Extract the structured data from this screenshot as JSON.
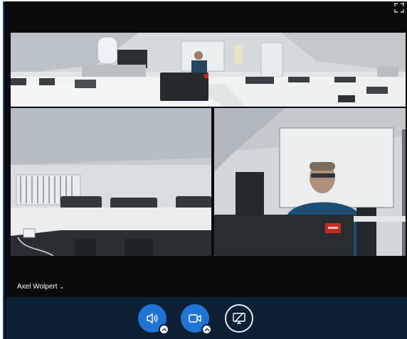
{
  "participant": {
    "name": "Axel Wolpert"
  },
  "controls": {
    "audio": "speaker-icon",
    "video": "camera-icon",
    "share": "screen-share-off-icon"
  },
  "colors": {
    "control_bar_bg": "#0c1f33",
    "button_blue": "#1f74d6",
    "window_bg": "#0a0a0a"
  }
}
